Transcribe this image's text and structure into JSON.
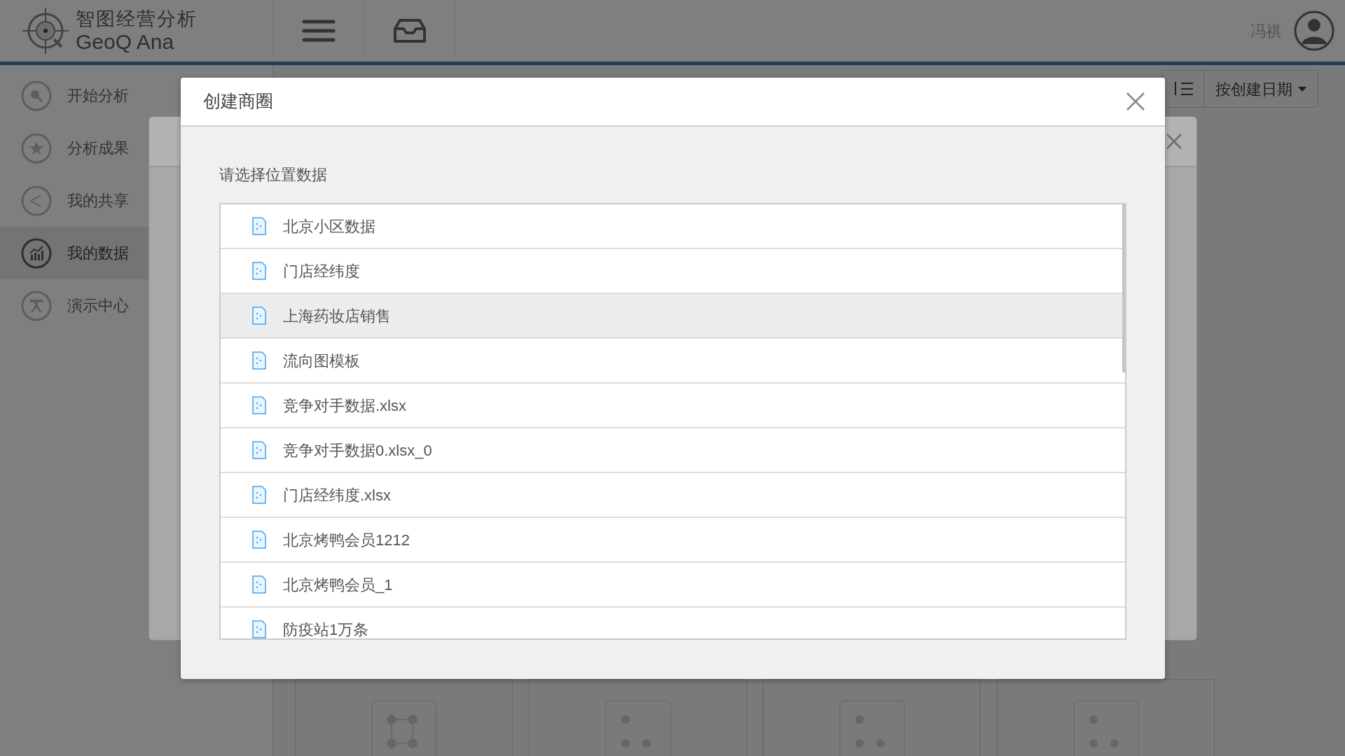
{
  "header": {
    "logo_title": "智图经营分析",
    "logo_subtitle": "GeoQ Ana",
    "user_name": "冯祺"
  },
  "sidebar": {
    "items": [
      {
        "label": "开始分析",
        "kind": "search",
        "selected": false
      },
      {
        "label": "分析成果",
        "kind": "star",
        "selected": false
      },
      {
        "label": "我的共享",
        "kind": "share",
        "selected": false
      },
      {
        "label": "我的数据",
        "kind": "chart",
        "selected": true
      },
      {
        "label": "演示中心",
        "kind": "easel",
        "selected": false
      }
    ]
  },
  "toolbar": {
    "sort_button": "按创建日期"
  },
  "cards": [
    {
      "kind": "square"
    },
    {
      "kind": "dots"
    },
    {
      "kind": "dots"
    },
    {
      "kind": "dots"
    }
  ],
  "dialog": {
    "title": "创建商圈",
    "prompt": "请选择位置数据",
    "items": [
      {
        "label": "北京小区数据",
        "selected": false
      },
      {
        "label": "门店经纬度",
        "selected": false
      },
      {
        "label": "上海药妆店销售",
        "selected": true
      },
      {
        "label": "流向图模板",
        "selected": false
      },
      {
        "label": "竞争对手数据.xlsx",
        "selected": false
      },
      {
        "label": "竞争对手数据0.xlsx_0",
        "selected": false
      },
      {
        "label": "门店经纬度.xlsx",
        "selected": false
      },
      {
        "label": "北京烤鸭会员1212",
        "selected": false
      },
      {
        "label": "北京烤鸭会员_1",
        "selected": false
      },
      {
        "label": "防疫站1万条",
        "selected": false
      }
    ]
  }
}
